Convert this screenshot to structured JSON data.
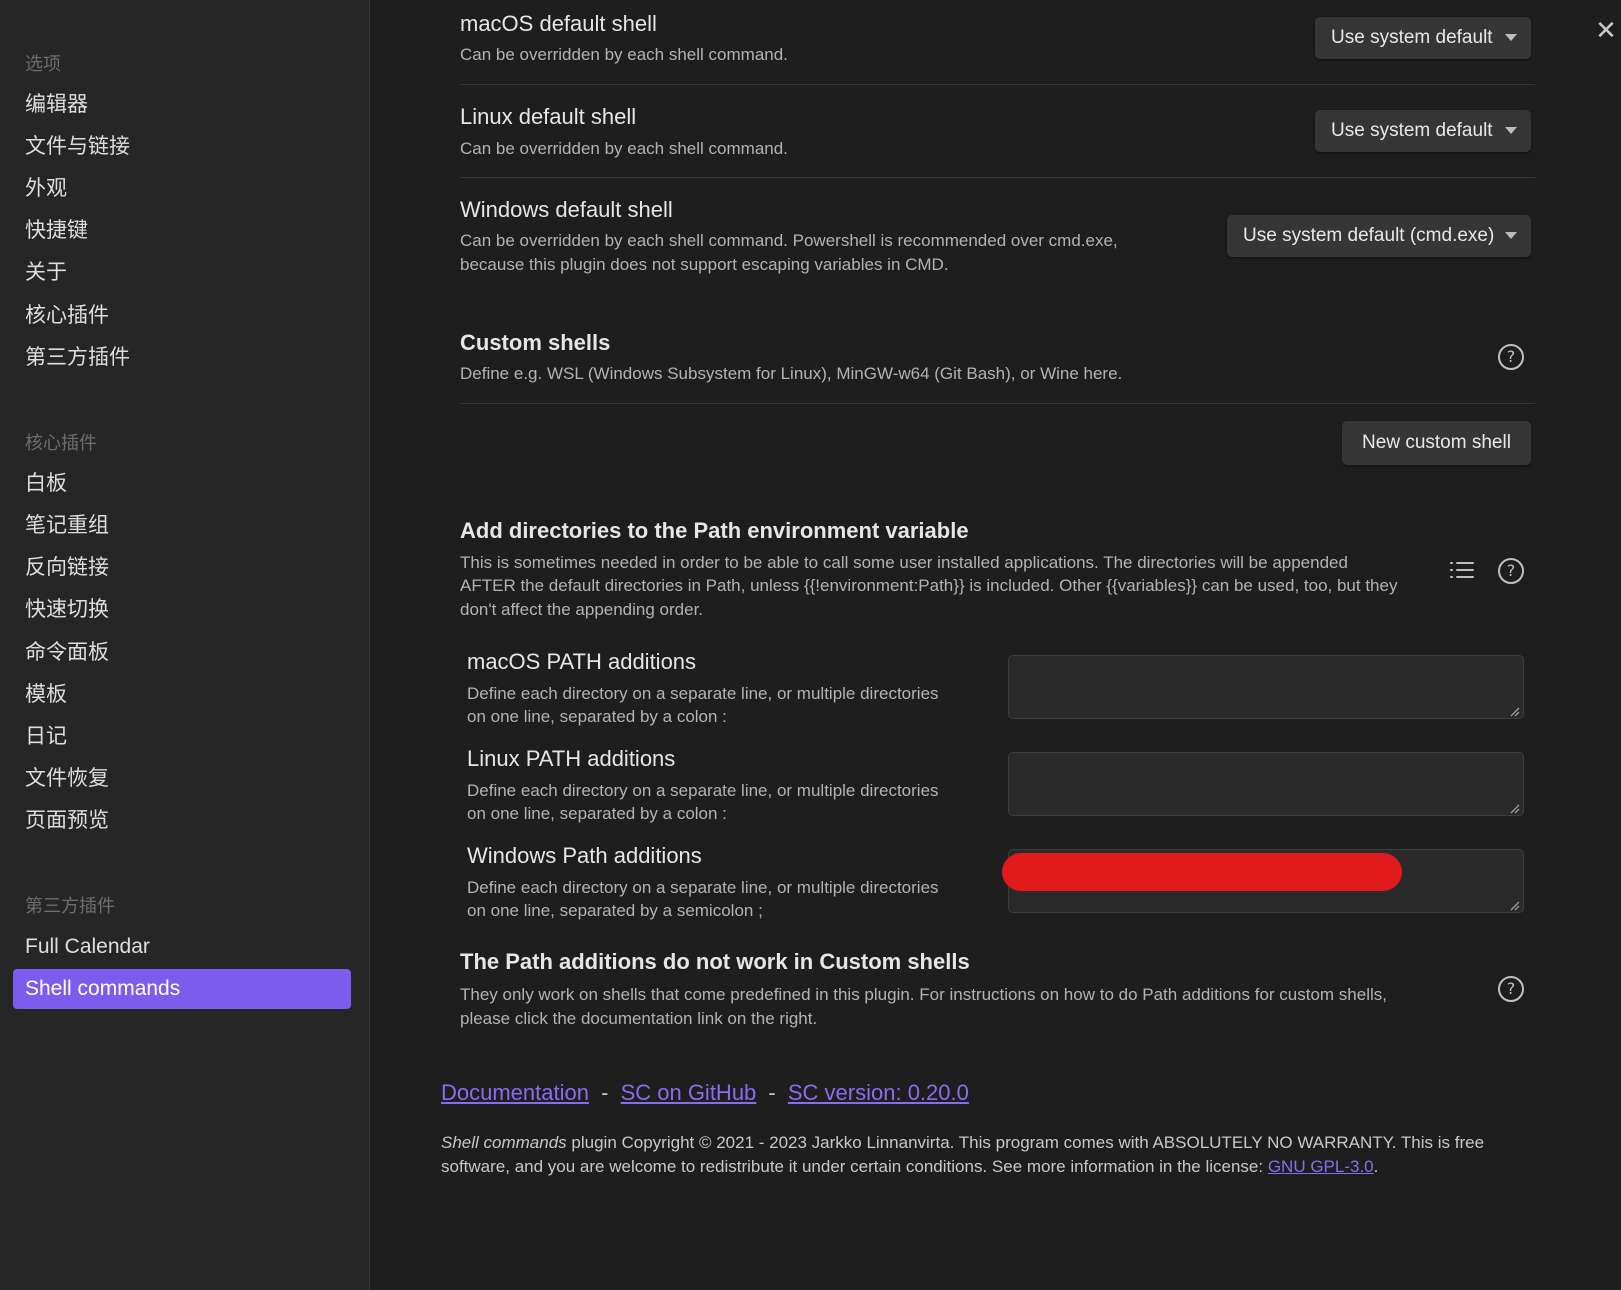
{
  "sidebar": {
    "options_header": "选项",
    "options_items": [
      "编辑器",
      "文件与链接",
      "外观",
      "快捷键",
      "关于",
      "核心插件",
      "第三方插件"
    ],
    "core_header": "核心插件",
    "core_items": [
      "白板",
      "笔记重组",
      "反向链接",
      "快速切换",
      "命令面板",
      "模板",
      "日记",
      "文件恢复",
      "页面预览"
    ],
    "third_party_header": "第三方插件",
    "third_party_items": [
      "Full Calendar",
      "Shell commands"
    ],
    "active_item": "Shell commands"
  },
  "settings": {
    "macos_shell": {
      "title": "macOS default shell",
      "desc": "Can be overridden by each shell command.",
      "value": "Use system default"
    },
    "linux_shell": {
      "title": "Linux default shell",
      "desc": "Can be overridden by each shell command.",
      "value": "Use system default"
    },
    "windows_shell": {
      "title": "Windows default shell",
      "desc_line1": "Can be overridden by each shell command. Powershell is recommended over cmd.exe,",
      "desc_line2": "because this plugin does not support escaping variables in CMD.",
      "value": "Use system default (cmd.exe)"
    },
    "custom_shells": {
      "title": "Custom shells",
      "desc": "Define e.g. WSL (Windows Subsystem for Linux), MinGW-w64 (Git Bash), or Wine here.",
      "button": "New custom shell"
    },
    "path_additions": {
      "title": "Add directories to the Path environment variable",
      "desc_line1": "This is sometimes needed in order to be able to call some user installed applications. The directories will be appended",
      "desc_line2": "AFTER the default directories in Path, unless {{!environment:Path}} is included. Other {{variables}} can be used, too, but they",
      "desc_line3": "don't affect the appending order."
    },
    "macos_path": {
      "title": "macOS PATH additions",
      "desc_line1": "Define each directory on a separate line, or multiple directories",
      "desc_line2": "on one line, separated by a colon :",
      "value": ""
    },
    "linux_path": {
      "title": "Linux PATH additions",
      "desc_line1": "Define each directory on a separate line, or multiple directories",
      "desc_line2": "on one line, separated by a colon :",
      "value": ""
    },
    "windows_path": {
      "title": "Windows Path additions",
      "desc_line1": "Define each directory on a separate line, or multiple directories",
      "desc_line2": "on one line, separated by a semicolon ;"
    },
    "path_note": {
      "title": "The Path additions do not work in Custom shells",
      "desc_line1": "They only work on shells that come predefined in this plugin. For instructions on how to do Path additions for custom shells,",
      "desc_line2": "please click the documentation link on the right."
    }
  },
  "footer": {
    "doc_link": "Documentation",
    "separator": "-",
    "github_link": "SC on GitHub",
    "version_link": "SC version: 0.20.0",
    "plugin_name": "Shell commands",
    "copyright_line1": " plugin Copyright © 2021 - 2023 Jarkko Linnanvirta. This program comes with ABSOLUTELY NO WARRANTY. This is free",
    "copyright_line2": "software, and you are welcome to redistribute it under certain conditions. See more information in the license: ",
    "license_link": "GNU GPL-3.0",
    "period": "."
  },
  "icons": {
    "close": "close-icon",
    "help": "help-circle-icon",
    "list": "list-icon",
    "dropdown": "chevron-down-icon"
  },
  "colors": {
    "accent": "#7c5cec",
    "link": "#8a6cf1",
    "background": "#1e1e1e",
    "sidebar": "#262626",
    "redaction": "#e11b1b"
  }
}
